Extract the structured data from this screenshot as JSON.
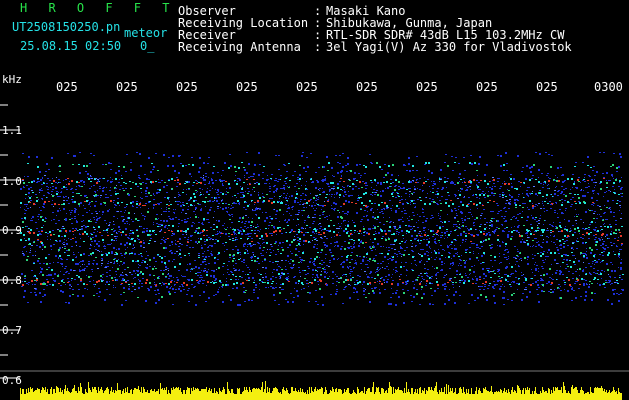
{
  "header": {
    "title": "H R O F F T",
    "filename": "UT2508150250.pn",
    "mode": "meteor",
    "datetime": "25.08.15 02:50",
    "count": "0_",
    "fields": [
      {
        "label": "Observer",
        "value": "Masaki Kano"
      },
      {
        "label": "Receiving Location",
        "value": "Shibukawa, Gunma, Japan"
      },
      {
        "label": "Receiver",
        "value": "RTL-SDR SDR# 43dB L15 103.2MHz CW"
      },
      {
        "label": "Receiving Antenna",
        "value": "3el Yagi(V) Az 330 for Vladivostok"
      }
    ]
  },
  "axis": {
    "unit": "kHz",
    "x_ticks": [
      "025",
      "025",
      "025",
      "025",
      "025",
      "025",
      "025",
      "025",
      "025",
      "0300"
    ],
    "y_ticks": [
      "1.1",
      "1.0",
      "0.9",
      "0.8",
      "0.7",
      "0.6"
    ]
  },
  "colors": {
    "background": "#000000",
    "title": "#27e34a",
    "text": "#25e1e6",
    "band_weak": "#1e2fd8",
    "band_strong": "#21e5e0",
    "band_peak": "#e63a2a",
    "signal_level": "#f4ef10"
  }
}
